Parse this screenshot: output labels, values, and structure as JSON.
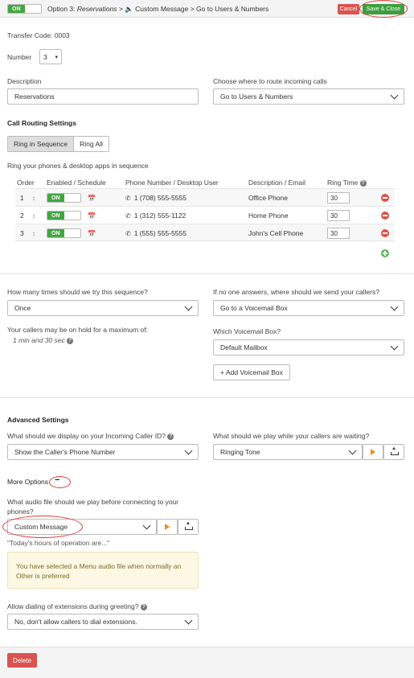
{
  "header": {
    "toggle_label": "ON",
    "option_prefix": "Option 3:",
    "option_name": "Reservations",
    "sep1": ">",
    "speaker_icon": "speaker-icon",
    "custom_message": "Custom Message",
    "sep2": ">",
    "destination": "Go to Users & Numbers",
    "cancel_label": "Cancel",
    "save_label": "Save & Close"
  },
  "transfer_code": "Transfer Code: 0003",
  "number": {
    "label": "Number",
    "value": "3"
  },
  "description": {
    "label": "Description",
    "value": "Reservations"
  },
  "route": {
    "label": "Choose where to route incoming calls",
    "value": "Go to Users & Numbers"
  },
  "call_routing": {
    "title": "Call Routing Settings",
    "seg_sequence": "Ring in Sequence",
    "seg_all": "Ring All",
    "subtitle": "Ring your phones & desktop apps in sequence",
    "columns": {
      "order": "Order",
      "enabled": "Enabled / Schedule",
      "phone": "Phone Number / Desktop User",
      "desc": "Description / Email",
      "ring": "Ring Time"
    },
    "rows": [
      {
        "order": "1",
        "toggle": "ON",
        "phone": "1 (708) 555-5555",
        "desc": "Office Phone",
        "ring": "30"
      },
      {
        "order": "2",
        "toggle": "ON",
        "phone": "1 (312) 555-1122",
        "desc": "Home Phone",
        "ring": "30"
      },
      {
        "order": "3",
        "toggle": "ON",
        "phone": "1 (555) 555-5555",
        "desc": "John's Cell Phone",
        "ring": "30"
      }
    ]
  },
  "sequence": {
    "tries_label": "How many times should we try this sequence?",
    "tries_value": "Once",
    "hold_label": "Your callers may be on hold for a maximum of:",
    "hold_value": "1 min and 30 sec",
    "noanswer_label": "If no one answers, where should we send your callers?",
    "noanswer_value": "Go to a Voicemail Box",
    "vm_label": "Which Voicemail Box?",
    "vm_value": "Default Mailbox",
    "add_vm_label": "+ Add Voicemail Box"
  },
  "advanced": {
    "title": "Advanced Settings",
    "callerid_label": "What should we display on your Incoming Caller ID?",
    "callerid_value": "Show the Caller's Phone Number",
    "waiting_label": "What should we play while your callers are waiting?",
    "waiting_value": "Ringing Tone"
  },
  "more_options": {
    "title": "More Options",
    "toggle_symbol": "−",
    "audio_label": "What audio file should we play before connecting to your phones?",
    "audio_value": "Custom Message",
    "audio_quote": "\"Today's hours of operation are...\"",
    "warning": "You have selected a Menu audio file when normally an Other is preferred",
    "dialing_label": "Allow dialing of extensions during greeting?",
    "dialing_value": "No, don't allow callers to dial extensions."
  },
  "footer": {
    "delete_label": "Delete"
  },
  "colors": {
    "green": "#3e9f3e",
    "red": "#d9534f",
    "orange": "#f08a24",
    "annotation": "#e03a3a"
  }
}
